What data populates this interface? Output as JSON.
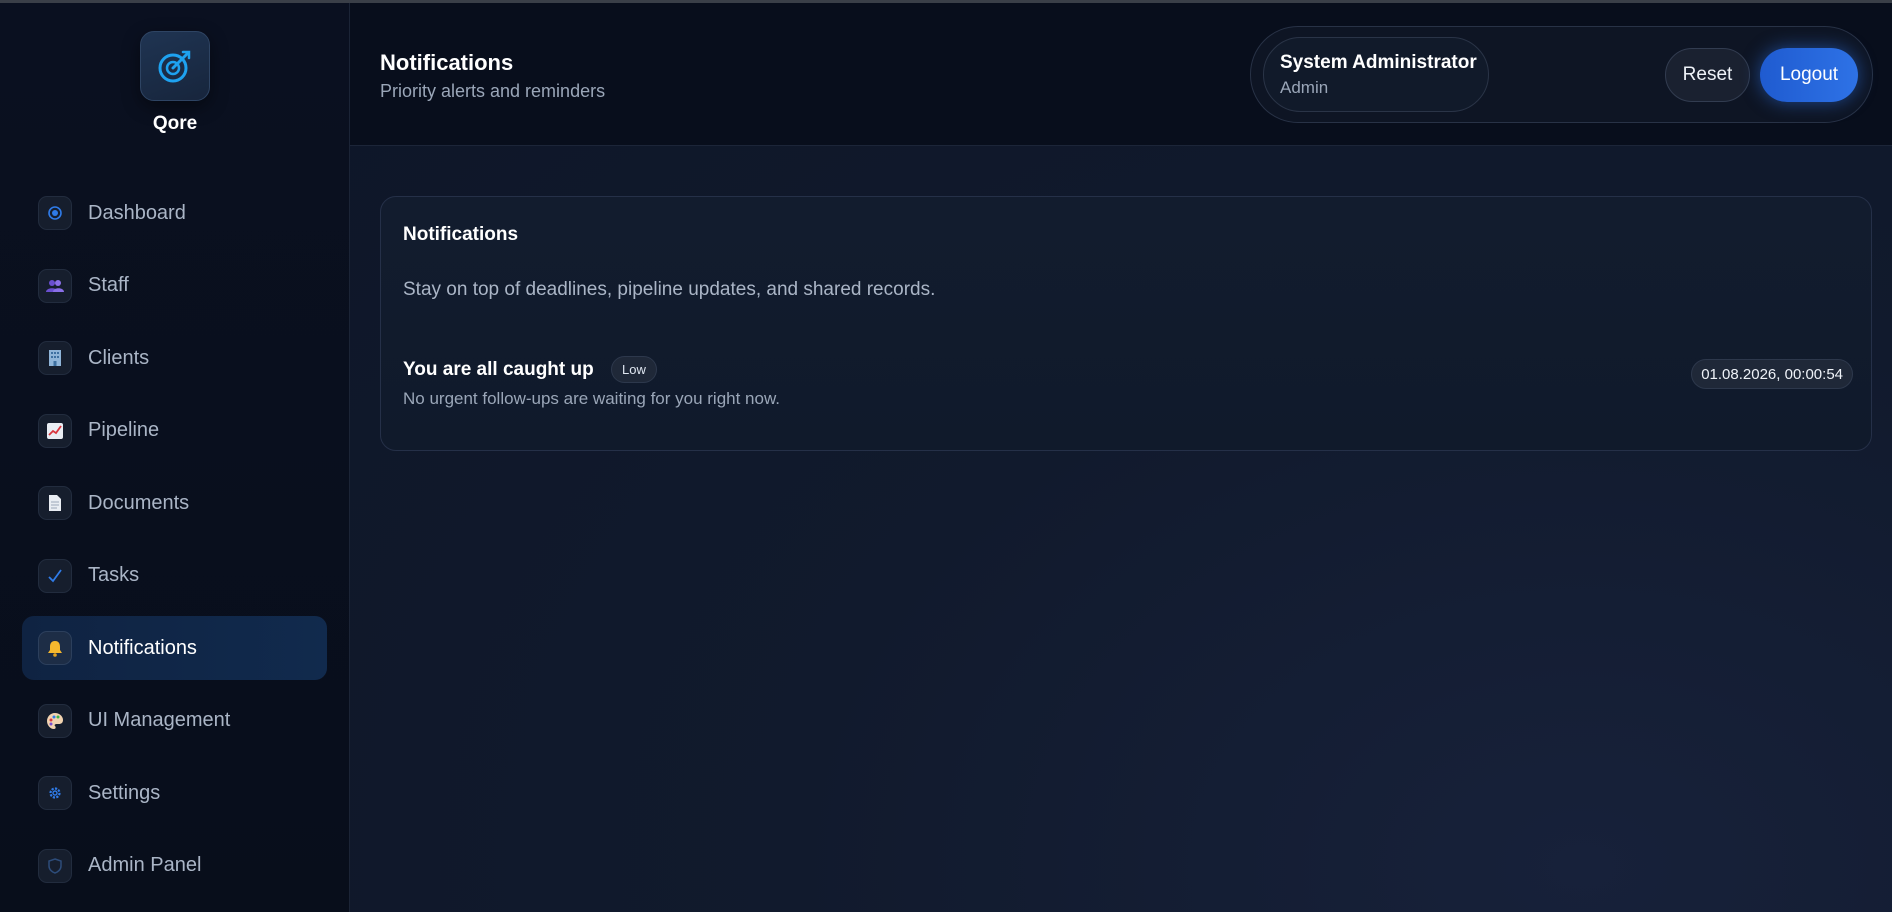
{
  "brand": {
    "name": "Qore",
    "logo_icon": "compass-icon"
  },
  "sidebar": {
    "items": [
      {
        "label": "Dashboard",
        "icon": "target-icon",
        "active": false
      },
      {
        "label": "Staff",
        "icon": "people-icon",
        "active": false
      },
      {
        "label": "Clients",
        "icon": "office-building-icon",
        "active": false
      },
      {
        "label": "Pipeline",
        "icon": "chart-increasing-icon",
        "active": false
      },
      {
        "label": "Documents",
        "icon": "document-icon",
        "active": false
      },
      {
        "label": "Tasks",
        "icon": "check-icon",
        "active": false
      },
      {
        "label": "Notifications",
        "icon": "bell-icon",
        "active": true
      },
      {
        "label": "UI Management",
        "icon": "palette-icon",
        "active": false
      },
      {
        "label": "Settings",
        "icon": "gear-icon",
        "active": false
      },
      {
        "label": "Admin Panel",
        "icon": "shield-icon",
        "active": false
      }
    ]
  },
  "header": {
    "title": "Notifications",
    "subtitle": "Priority alerts and reminders",
    "user": {
      "name": "System Administrator",
      "role": "Admin"
    },
    "reset_label": "Reset",
    "logout_label": "Logout"
  },
  "card": {
    "title": "Notifications",
    "description": "Stay on top of deadlines, pipeline updates, and shared records.",
    "notification": {
      "title": "You are all caught up",
      "priority": "Low",
      "body": "No urgent follow-ups are waiting for you right now.",
      "timestamp": "01.08.2026, 00:00:54"
    }
  },
  "colors": {
    "accent": "#2e72e6",
    "active_nav_bg": "#112a4d",
    "background": "#0b1222"
  }
}
